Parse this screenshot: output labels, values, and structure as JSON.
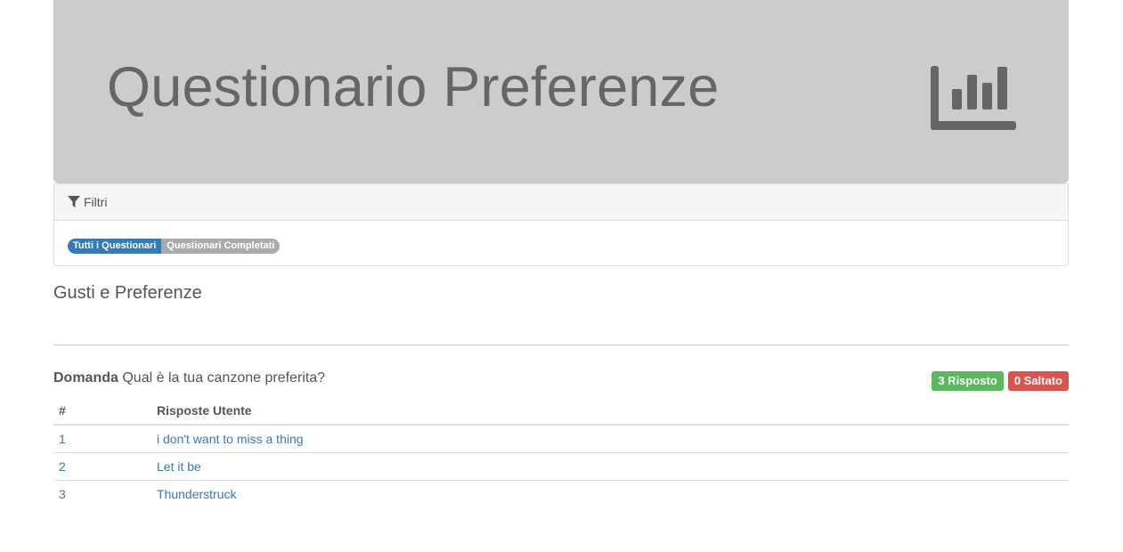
{
  "header": {
    "title": "Questionario Preferenze",
    "icon": "bar-chart-icon"
  },
  "filters": {
    "heading": "Filtri",
    "icon": "filter-icon",
    "options": [
      "Tutti i Questionari",
      "Questionari Completati"
    ],
    "active": "Tutti i Questionari"
  },
  "section": {
    "title": "Gusti e Preferenze"
  },
  "question": {
    "label": "Domanda",
    "text": "Qual è la tua canzone preferita?",
    "answered_badge": "3 Risposto",
    "skipped_badge": "0 Saltato"
  },
  "table": {
    "headers": [
      "#",
      "Risposte Utente"
    ],
    "rows": [
      {
        "num": "1",
        "answer": "i don't want to miss a thing"
      },
      {
        "num": "2",
        "answer": "Let it be"
      },
      {
        "num": "3",
        "answer": "Thunderstruck"
      }
    ]
  },
  "colors": {
    "jumbotron": "#cccccc",
    "primary": "#337ab7",
    "success": "#5cb85c",
    "danger": "#d9534f"
  }
}
